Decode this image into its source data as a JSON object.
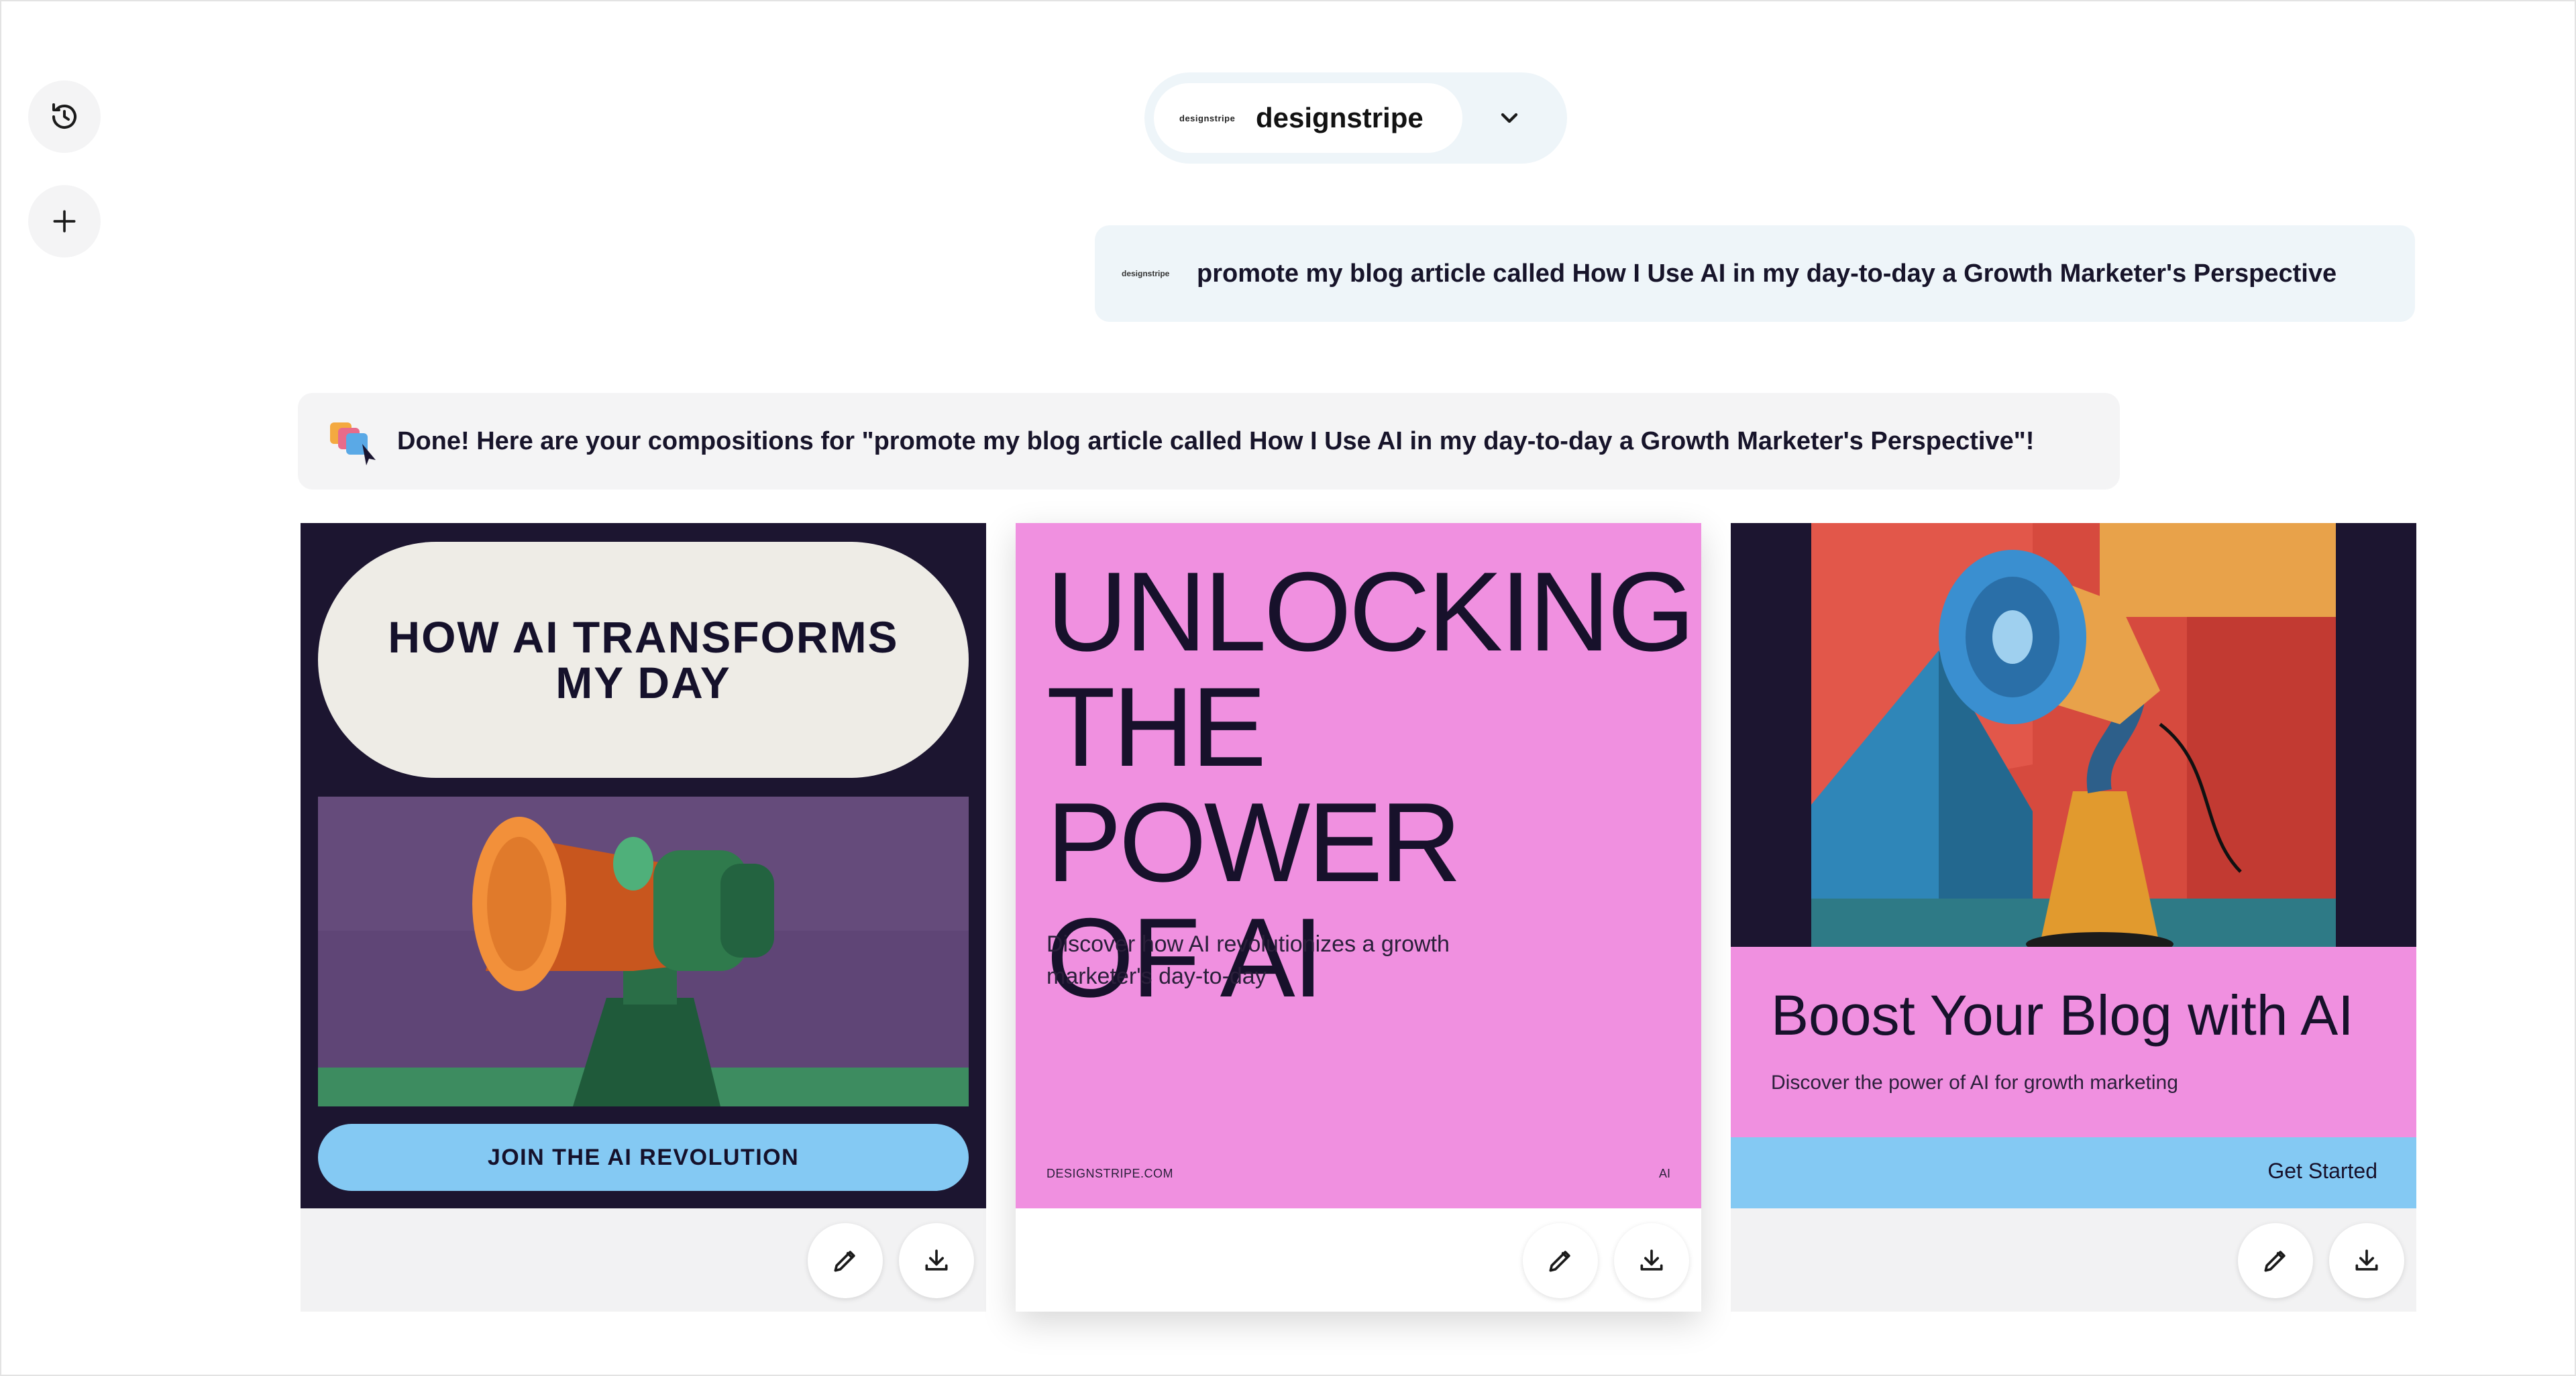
{
  "sidebar": {
    "history_icon": "history-icon",
    "new_icon": "plus-icon"
  },
  "brand_selector": {
    "logo_text": "designstripe",
    "name": "designstripe",
    "chevron": "chevron-down-icon"
  },
  "user_message": {
    "logo_text": "designstripe",
    "text": "promote my blog article called How I Use AI in my day-to-day a Growth Marketer's Perspective"
  },
  "assistant_message": {
    "text": "Done! Here are your compositions for \"promote my blog article called How I Use AI in my day-to-day a Growth Marketer's Perspective\"!"
  },
  "compositions": [
    {
      "headline": "HOW AI TRANSFORMS MY DAY",
      "cta": "JOIN THE AI REVOLUTION",
      "colors": {
        "background": "#1c1530",
        "pill": "#eeece6",
        "cta": "#84c9f3"
      }
    },
    {
      "headline_lines": [
        "UNLOCKING",
        "THE POWER",
        "OF AI"
      ],
      "subtext": "Discover how AI revolutionizes a growth marketer's day-to-day",
      "footer_left": "DESIGNSTRIPE.COM",
      "footer_right": "AI",
      "colors": {
        "background": "#f090e0"
      }
    },
    {
      "headline": "Boost Your Blog with AI",
      "subtext": "Discover the power of AI for growth marketing",
      "cta": "Get Started",
      "colors": {
        "pink": "#f090e0",
        "blue": "#84c9f3"
      }
    }
  ],
  "card_actions": {
    "edit_icon": "pencil-icon",
    "download_icon": "download-icon"
  }
}
